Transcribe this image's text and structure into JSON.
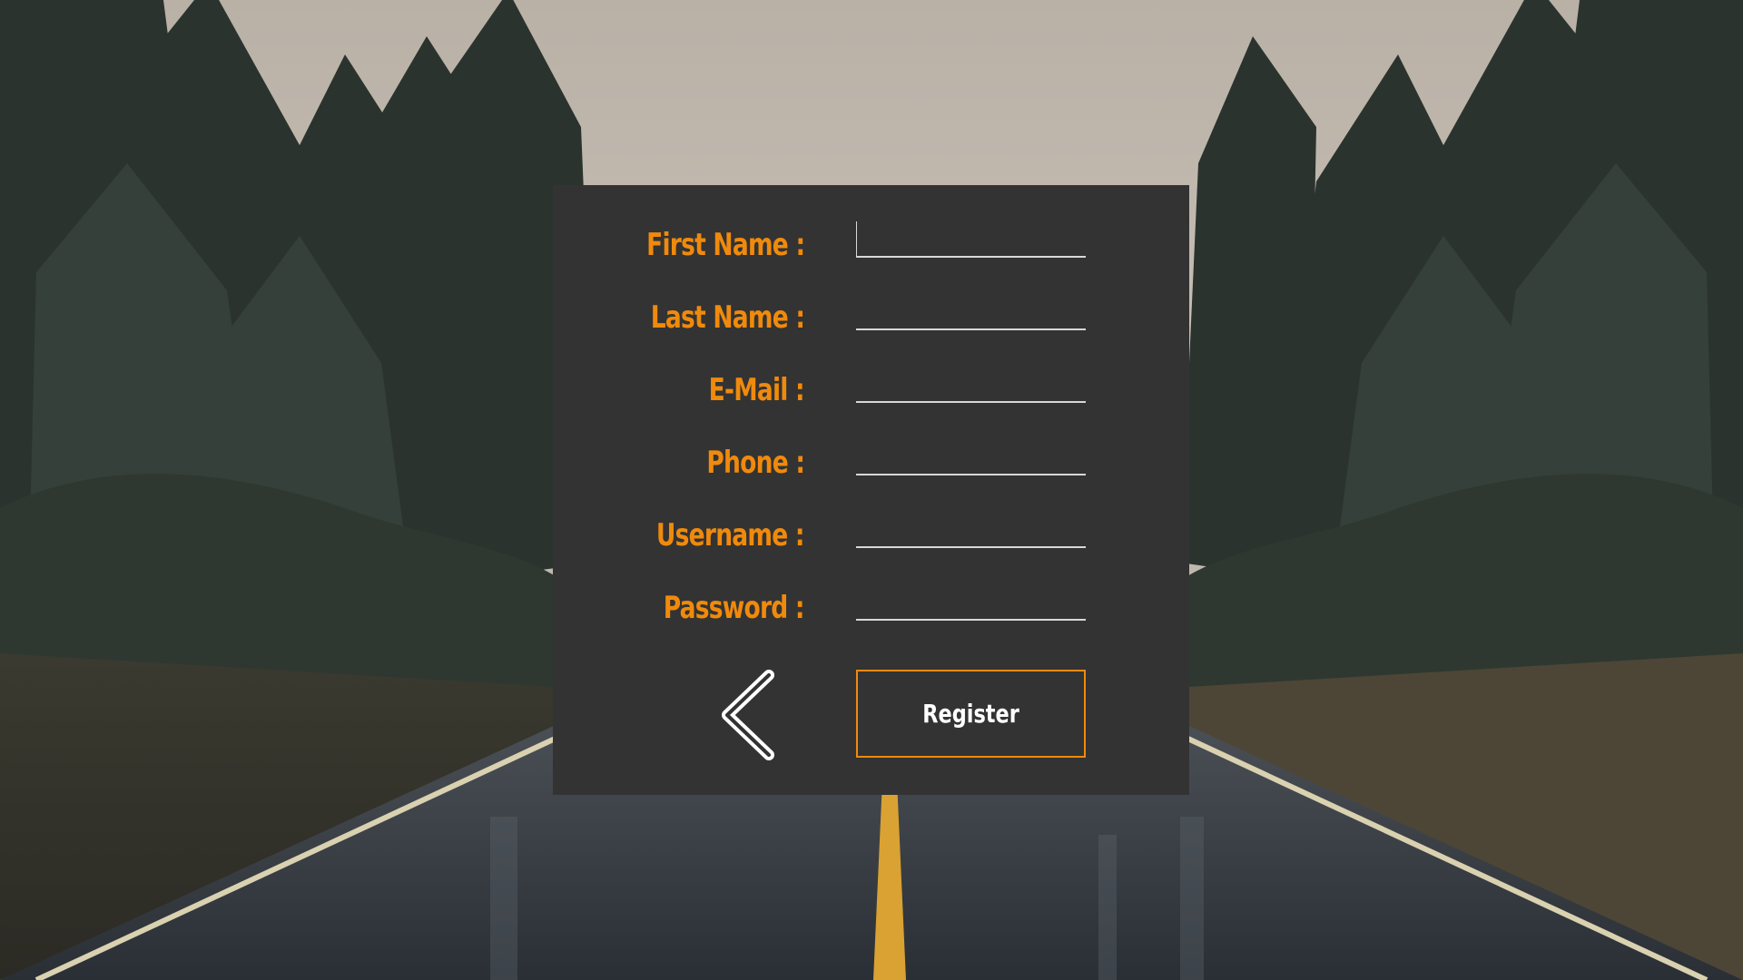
{
  "theme": {
    "label_color": "#f08a0c",
    "panel_color": "#333333",
    "button_border_color": "#f08a0c"
  },
  "form": {
    "fields": [
      {
        "label": "First Name :",
        "value": "",
        "focused": true
      },
      {
        "label": "Last Name :",
        "value": ""
      },
      {
        "label": "E-Mail :",
        "value": ""
      },
      {
        "label": "Phone :",
        "value": ""
      },
      {
        "label": "Username :",
        "value": ""
      },
      {
        "label": "Password :",
        "value": ""
      }
    ],
    "register_label": "Register",
    "back_icon": "chevron-left-icon"
  }
}
